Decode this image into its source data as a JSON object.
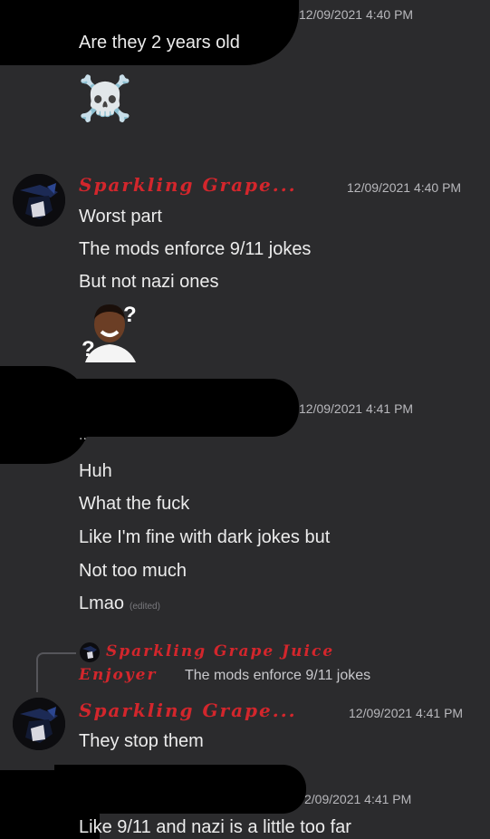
{
  "messages": [
    {
      "timestamp": "12/09/2021 4:40 PM",
      "lines": [
        "Are they 2 years old"
      ],
      "emoji": "☠️"
    },
    {
      "username": "Sparkling Grape...",
      "timestamp": "12/09/2021 4:40 PM",
      "lines": [
        "Worst part",
        "The mods enforce 9/11 jokes",
        "But not nazi ones"
      ],
      "sticker": "?"
    },
    {
      "timestamp": "12/09/2021 4:41 PM",
      "lines": [
        "..",
        "Huh",
        "What the fuck",
        "Like I'm fine with dark jokes but",
        "Not too much",
        "Lmao"
      ],
      "edited": "(edited)"
    },
    {
      "reply": {
        "username_line1": "Sparkling Grape Juice",
        "username_line2": "Enjoyer",
        "text": "The mods enforce 9/11 jokes"
      },
      "username": "Sparkling Grape...",
      "timestamp": "12/09/2021 4:41 PM",
      "lines": [
        "They stop them"
      ]
    },
    {
      "timestamp": "2/09/2021 4:41 PM",
      "lines": [
        "Like 9/11 and nazi is a little too far"
      ]
    }
  ],
  "colors": {
    "background": "#2b2b2d",
    "username": "#d3262c",
    "timestamp": "#b8b8bc"
  }
}
